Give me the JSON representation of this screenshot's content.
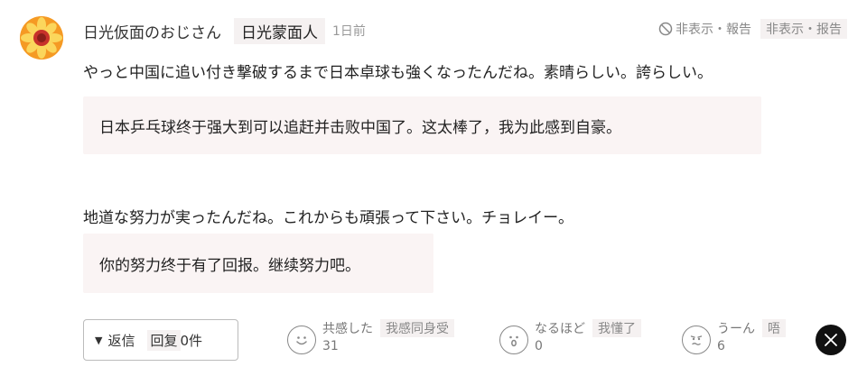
{
  "comment": {
    "username": "日光仮面のおじさん",
    "username_translation": "日光蒙面人",
    "time": "1日前",
    "report_label": "非表示・報告",
    "report_translation": "非表示・报告",
    "paragraph1": "やっと中国に追い付き撃破するまで日本卓球も強くなったんだね。素晴らしい。誇らしい。",
    "translation1": "日本乒乓球终于强大到可以追赶并击败中国了。这太棒了，我为此感到自豪。",
    "paragraph2": "地道な努力が実ったんだね。これからも頑張って下さい。チョレイー。",
    "translation2": "你的努力终于有了回报。继续努力吧。"
  },
  "actions": {
    "reply_label": "返信",
    "reply_translation": "回复",
    "reply_count": "0件"
  },
  "reactions": [
    {
      "label": "共感した",
      "translation": "我感同身受",
      "count": "31",
      "icon": "smile-face-icon"
    },
    {
      "label": "なるほど",
      "translation": "我懂了",
      "count": "0",
      "icon": "surprised-face-icon"
    },
    {
      "label": "うーん",
      "translation": "唔",
      "count": "6",
      "icon": "thinking-face-icon"
    }
  ],
  "share": {
    "icon": "x-logo-icon"
  },
  "colors": {
    "badge_bg": "#f5f1f1",
    "box_bg": "#faf4f4",
    "muted_text": "#888888"
  }
}
